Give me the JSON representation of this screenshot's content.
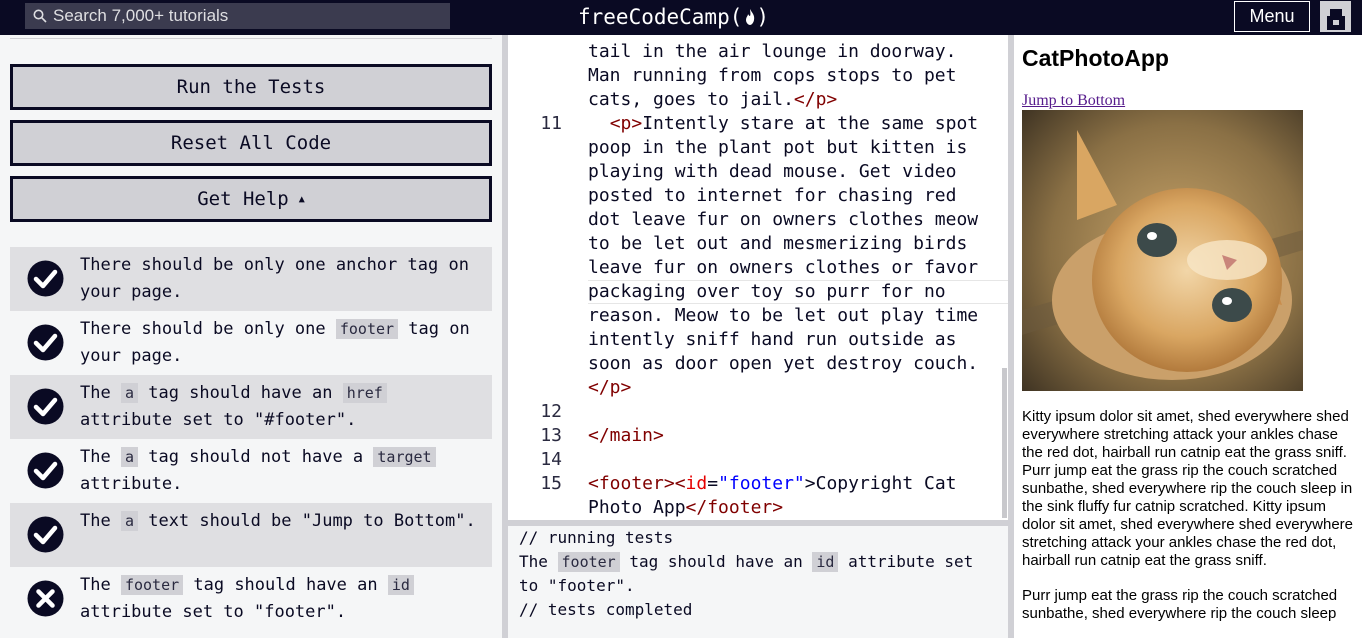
{
  "nav": {
    "search_placeholder": "Search 7,000+ tutorials",
    "logo_text": "freeCodeCamp(",
    "logo_end": ")",
    "menu_label": "Menu"
  },
  "buttons": {
    "run_tests": "Run the Tests",
    "reset_code": "Reset All Code",
    "get_help": "Get Help"
  },
  "tests": [
    {
      "status": "pass",
      "parts": [
        "There should be only one anchor tag on your page."
      ]
    },
    {
      "status": "pass",
      "pre": "There should be only one ",
      "code": "footer",
      "post": " tag on your page."
    },
    {
      "status": "pass",
      "pre": "The ",
      "code": "a",
      "mid": " tag should have an ",
      "code2": "href",
      "post": " attribute set to \"#footer\"."
    },
    {
      "status": "pass",
      "pre": "The ",
      "code": "a",
      "mid": " tag should not have a ",
      "code2": "target",
      "post": " attribute."
    },
    {
      "status": "pass",
      "pre": "The ",
      "code": "a",
      "post": " text should be \"Jump to Bottom\"."
    },
    {
      "status": "fail",
      "pre": "The ",
      "code": "footer",
      "mid": " tag should have an ",
      "code2": "id",
      "post": " attribute set to \"footer\"."
    }
  ],
  "editor": {
    "l0": "tail in the air lounge in doorway.",
    "l1": "Man running from cops stops to pet",
    "l2a": "cats, goes to jail.",
    "l2b": "</p>",
    "n11": "11",
    "l3a": "<p>",
    "l3b": "Intently stare at the same spot",
    "l4": "poop in the plant pot but kitten is",
    "l5": "playing with dead mouse. Get video",
    "l6": "posted to internet for chasing red",
    "l7": "dot leave fur on owners clothes meow",
    "l8": "to be let out and mesmerizing birds",
    "l9": "leave fur on owners clothes or favor",
    "l10": "packaging over toy so purr for no",
    "l11": "reason. Meow to be let out play time",
    "l12": "intently sniff hand run outside as",
    "l13": "soon as door open yet destroy couch.",
    "l14": "</p>",
    "n12": "12",
    "n13": "13",
    "l16": "</main>",
    "n14": "14",
    "n15": "15",
    "l18a": "<footer><",
    "l18b": "id",
    "l18c": "=",
    "l18d": "\"footer\"",
    "l18e": ">Copyright Cat",
    "l19a": "Photo App",
    "l19b": "</footer>",
    "l19c": ">"
  },
  "console": {
    "line1": "// running tests",
    "line2_pre": "The ",
    "line2_code": "footer",
    "line2_mid": " tag should have an ",
    "line2_code2": "id",
    "line2_post": " attribute set",
    "line3": "to \"footer\".",
    "line4": "// tests completed"
  },
  "preview": {
    "title": "CatPhotoApp",
    "jump_link": "Jump to Bottom",
    "para1": "Kitty ipsum dolor sit amet, shed everywhere shed everywhere stretching attack your ankles chase the red dot, hairball run catnip eat the grass sniff. Purr jump eat the grass rip the couch scratched sunbathe, shed everywhere rip the couch sleep in the sink fluffy fur catnip scratched. Kitty ipsum dolor sit amet, shed everywhere shed everywhere stretching attack your ankles chase the red dot, hairball run catnip eat the grass sniff.",
    "para2": "Purr jump eat the grass rip the couch scratched sunbathe, shed everywhere rip the couch sleep"
  }
}
